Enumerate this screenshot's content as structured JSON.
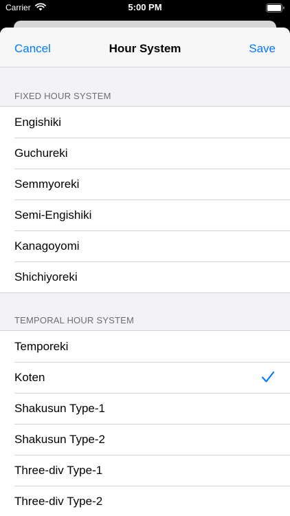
{
  "status_bar": {
    "carrier": "Carrier",
    "time": "5:00 PM",
    "icons": [
      "wifi-icon",
      "battery-icon"
    ]
  },
  "navbar": {
    "cancel_label": "Cancel",
    "title": "Hour System",
    "save_label": "Save"
  },
  "sections": [
    {
      "header": "FIXED HOUR SYSTEM",
      "items": [
        {
          "label": "Engishiki",
          "selected": false
        },
        {
          "label": "Guchureki",
          "selected": false
        },
        {
          "label": "Semmyoreki",
          "selected": false
        },
        {
          "label": "Semi-Engishiki",
          "selected": false
        },
        {
          "label": "Kanagoyomi",
          "selected": false
        },
        {
          "label": "Shichiyoreki",
          "selected": false
        }
      ]
    },
    {
      "header": "TEMPORAL HOUR SYSTEM",
      "items": [
        {
          "label": "Temporeki",
          "selected": false
        },
        {
          "label": "Koten",
          "selected": true
        },
        {
          "label": "Shakusun Type-1",
          "selected": false
        },
        {
          "label": "Shakusun Type-2",
          "selected": false
        },
        {
          "label": "Three-div Type-1",
          "selected": false
        },
        {
          "label": "Three-div Type-2",
          "selected": false
        }
      ]
    }
  ],
  "colors": {
    "accent": "#007aff",
    "grouped_background": "#f2f2f7",
    "separator": "#d1d1d6",
    "section_header_text": "#6d6d72"
  }
}
